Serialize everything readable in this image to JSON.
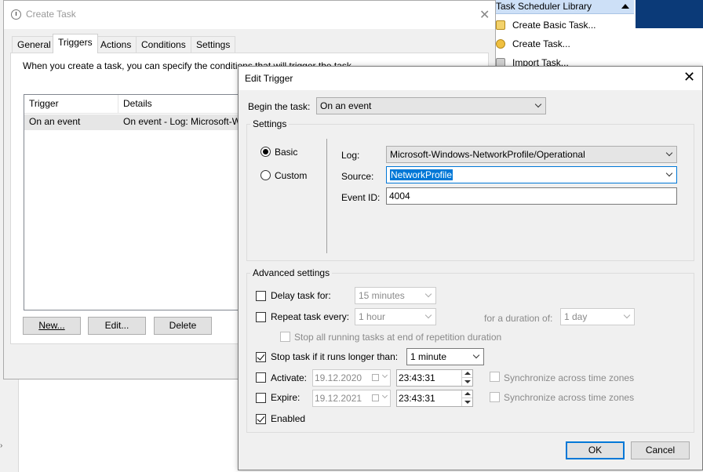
{
  "actions_panel": {
    "header": "Task Scheduler Library",
    "items": [
      {
        "label": "Create Basic Task...",
        "icon": "create-basic-task-icon"
      },
      {
        "label": "Create Task...",
        "icon": "create-task-icon"
      },
      {
        "label": "Import Task...",
        "icon": "import-task-icon"
      }
    ]
  },
  "create_task": {
    "title": "Create Task",
    "tabs": [
      "General",
      "Triggers",
      "Actions",
      "Conditions",
      "Settings"
    ],
    "active_tab": "Triggers",
    "intro": "When you create a task, you can specify the conditions that will trigger the task.",
    "columns": [
      "Trigger",
      "Details"
    ],
    "rows": [
      {
        "trigger": "On an event",
        "details": "On event - Log: Microsoft-Windows-NetworkProfile/Operational"
      }
    ],
    "buttons": {
      "new": "New...",
      "edit": "Edit...",
      "delete": "Delete"
    }
  },
  "edit_trigger": {
    "title": "Edit Trigger",
    "begin_label": "Begin the task:",
    "begin_value": "On an event",
    "settings_legend": "Settings",
    "radio_basic": "Basic",
    "radio_custom": "Custom",
    "selected_mode": "Basic",
    "log_label": "Log:",
    "log_value": "Microsoft-Windows-NetworkProfile/Operational",
    "source_label": "Source:",
    "source_value": "NetworkProfile",
    "eventid_label": "Event ID:",
    "eventid_value": "4004",
    "advanced_legend": "Advanced settings",
    "delay_label": "Delay task for:",
    "delay_value": "15 minutes",
    "delay_checked": false,
    "repeat_label": "Repeat task every:",
    "repeat_value": "1 hour",
    "repeat_checked": false,
    "duration_label": "for a duration of:",
    "duration_value": "1 day",
    "stop_running_label": "Stop all running tasks at end of repetition duration",
    "stop_longer_label": "Stop task if it runs longer than:",
    "stop_longer_value": "1 minute",
    "stop_longer_checked": true,
    "activate_label": "Activate:",
    "activate_date": "19.12.2020",
    "activate_time": "23:43:31",
    "activate_checked": false,
    "expire_label": "Expire:",
    "expire_date": "19.12.2021",
    "expire_time": "23:43:31",
    "expire_checked": false,
    "sync_label": "Synchronize across time zones",
    "enabled_label": "Enabled",
    "enabled_checked": true,
    "ok": "OK",
    "cancel": "Cancel",
    "accent_color": "#0078d7"
  }
}
